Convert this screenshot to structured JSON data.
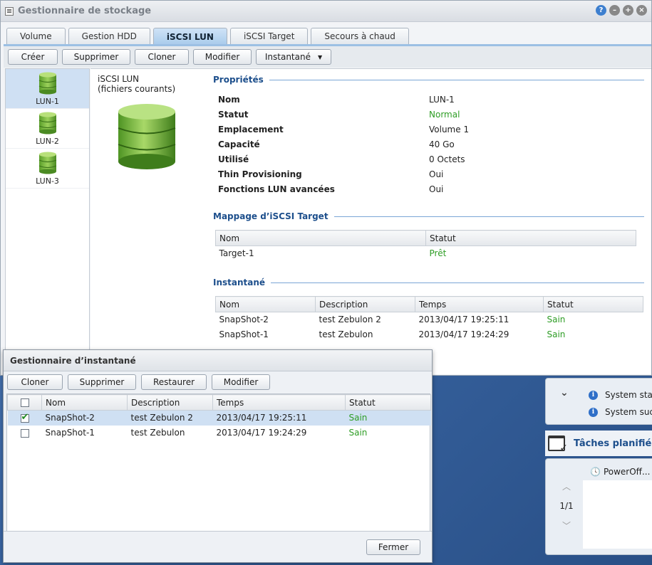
{
  "window": {
    "title": "Gestionnaire de stockage"
  },
  "tabs": [
    {
      "label": "Volume"
    },
    {
      "label": "Gestion HDD"
    },
    {
      "label": "iSCSI LUN"
    },
    {
      "label": "iSCSI Target"
    },
    {
      "label": "Secours à chaud"
    }
  ],
  "toolbar": {
    "create": "Créer",
    "delete": "Supprimer",
    "clone": "Cloner",
    "modify": "Modifier",
    "snapshot": "Instantané"
  },
  "lun_list": [
    {
      "label": "LUN-1",
      "selected": true
    },
    {
      "label": "LUN-2",
      "selected": false
    },
    {
      "label": "LUN-3",
      "selected": false
    }
  ],
  "detail": {
    "type_line1": "iSCSI LUN",
    "type_line2": "(fichiers courants)",
    "properties_title": "Propriétés",
    "properties": [
      {
        "key": "Nom",
        "value": "LUN-1"
      },
      {
        "key": "Statut",
        "value": "Normal"
      },
      {
        "key": "Emplacement",
        "value": "Volume 1"
      },
      {
        "key": "Capacité",
        "value": "40 Go"
      },
      {
        "key": "Utilisé",
        "value": "0 Octets"
      },
      {
        "key": "Thin Provisioning",
        "value": "Oui"
      },
      {
        "key": "Fonctions LUN avancées",
        "value": "Oui"
      }
    ],
    "mapping_title": "Mappage d’iSCSI Target",
    "mapping_columns": [
      "Nom",
      "Statut"
    ],
    "mapping_rows": [
      {
        "name": "Target-1",
        "status": "Prêt"
      }
    ],
    "snapshot_title": "Instantané",
    "snapshot_columns": [
      "Nom",
      "Description",
      "Temps",
      "Statut"
    ],
    "snapshot_rows": [
      {
        "name": "SnapShot-2",
        "description": "test Zebulon 2",
        "time": "2013/04/17 19:25:11",
        "status": "Sain"
      },
      {
        "name": "SnapShot-1",
        "description": "test Zebulon",
        "time": "2013/04/17 19:24:29",
        "status": "Sain"
      }
    ]
  },
  "dialog": {
    "title": "Gestionnaire d’instantané",
    "buttons": {
      "clone": "Cloner",
      "delete": "Supprimer",
      "restore": "Restaurer",
      "modify": "Modifier"
    },
    "columns": [
      "Nom",
      "Description",
      "Temps",
      "Statut"
    ],
    "rows": [
      {
        "checked": true,
        "name": "SnapShot-2",
        "description": "test Zebulon 2",
        "time": "2013/04/17 19:25:11",
        "status": "Sain",
        "selected": true
      },
      {
        "checked": false,
        "name": "SnapShot-1",
        "description": "test Zebulon",
        "time": "2013/04/17 19:24:29",
        "status": "Sain",
        "selected": false
      }
    ],
    "close": "Fermer"
  },
  "widgets": {
    "system_items": [
      "System sta",
      "System suc"
    ],
    "tasks_title": "Tâches planifiée",
    "task_item": "PowerOff...",
    "page": "1/1"
  },
  "colors": {
    "ok_green": "#2e9d25",
    "section_blue": "#1d4f8c",
    "selection": "#cfe0f3"
  }
}
